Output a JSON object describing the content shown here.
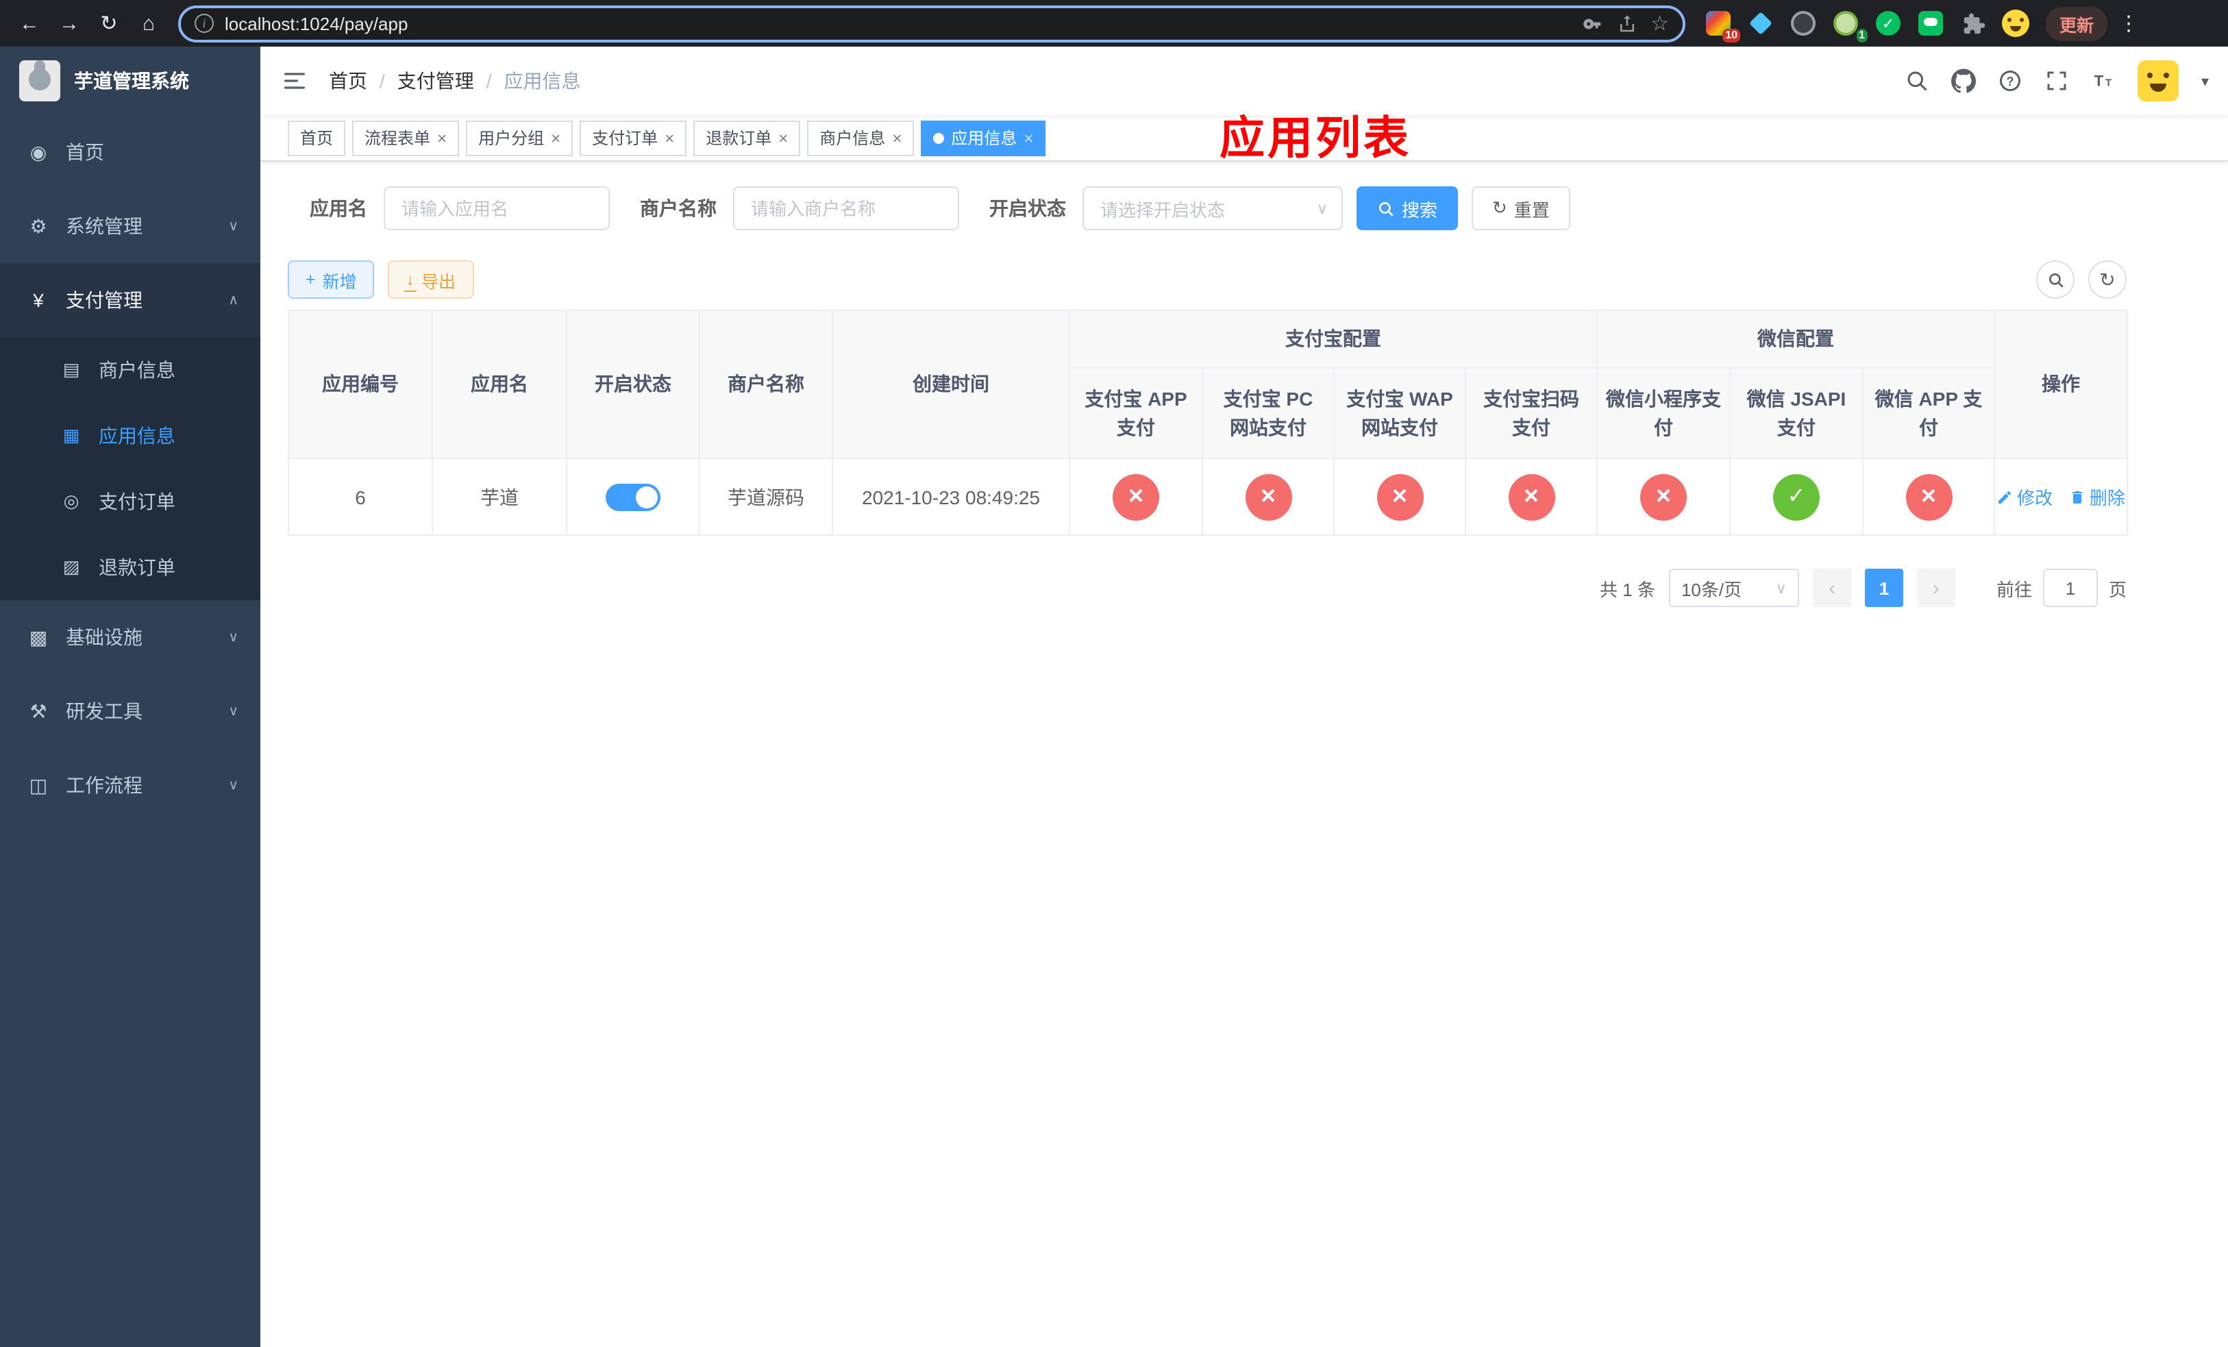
{
  "browser": {
    "url": "localhost:1024/pay/app",
    "update_label": "更新",
    "badges": {
      "extensions": "10",
      "profile_ext": "1"
    }
  },
  "app": {
    "annotation": "应用列表"
  },
  "icons": {
    "back": "←",
    "forward": "→",
    "reload": "↻",
    "home": "⌂",
    "info": "i",
    "star": "☆",
    "more": "⋮",
    "chevron_down": "∨",
    "chevron_up": "∧",
    "caret_down": "▾",
    "close": "×",
    "plus": "+",
    "download": "↓",
    "refresh": "↻",
    "check": "✓",
    "prev": "‹",
    "next": "›",
    "dashboard": "◉",
    "gear": "⚙",
    "yen": "¥",
    "monitor": "▩",
    "tool": "⚒",
    "flow": "◫",
    "card": "▤",
    "grid": "▦",
    "order": "◎",
    "doc": "▨"
  },
  "sidebar": {
    "title": "芋道管理系统",
    "items": [
      {
        "label": "首页"
      },
      {
        "label": "系统管理"
      },
      {
        "label": "支付管理",
        "children": [
          {
            "label": "商户信息"
          },
          {
            "label": "应用信息"
          },
          {
            "label": "支付订单"
          },
          {
            "label": "退款订单"
          }
        ]
      },
      {
        "label": "基础设施"
      },
      {
        "label": "研发工具"
      },
      {
        "label": "工作流程"
      }
    ]
  },
  "breadcrumb": {
    "separator": "/",
    "items": [
      "首页",
      "支付管理",
      "应用信息"
    ]
  },
  "tabs": [
    {
      "label": "首页"
    },
    {
      "label": "流程表单"
    },
    {
      "label": "用户分组"
    },
    {
      "label": "支付订单"
    },
    {
      "label": "退款订单"
    },
    {
      "label": "商户信息"
    },
    {
      "label": "应用信息"
    }
  ],
  "filters": {
    "app_name": {
      "label": "应用名",
      "placeholder": "请输入应用名"
    },
    "merchant_name": {
      "label": "商户名称",
      "placeholder": "请输入商户名称"
    },
    "status": {
      "label": "开启状态",
      "placeholder": "请选择开启状态"
    },
    "search_label": "搜索",
    "reset_label": "重置"
  },
  "actions": {
    "add_label": "新增",
    "export_label": "导出"
  },
  "table": {
    "group_headers": {
      "alipay": "支付宝配置",
      "wechat": "微信配置"
    },
    "columns": {
      "app_id": "应用编号",
      "app_name": "应用名",
      "status": "开启状态",
      "merchant_name": "商户名称",
      "create_time": "创建时间",
      "alipay_app": "支付宝 APP 支付",
      "alipay_pc": "支付宝 PC 网站支付",
      "alipay_wap": "支付宝 WAP 网站支付",
      "alipay_qr": "支付宝扫码支付",
      "wechat_mini": "微信小程序支付",
      "wechat_jsapi": "微信 JSAPI 支付",
      "wechat_app": "微信 APP 支付",
      "actions": "操作"
    },
    "rows": [
      {
        "app_id": "6",
        "app_name": "芋道",
        "status_on": true,
        "merchant_name": "芋道源码",
        "create_time": "2021-10-23 08:49:25",
        "config_statuses": [
          "disabled",
          "disabled",
          "disabled",
          "disabled",
          "disabled",
          "enabled",
          "disabled"
        ],
        "edit_label": "修改",
        "delete_label": "删除"
      }
    ]
  },
  "pagination": {
    "total_label": "共 1 条",
    "page_size_label": "10条/页",
    "current_page": "1",
    "goto_label": "前往",
    "goto_value": "1",
    "goto_suffix": "页"
  },
  "colors": {
    "accent": "#409eff",
    "success": "#67c23a",
    "danger": "#f56c6c",
    "warning_text": "#e6a23c",
    "sidebar_bg": "#304156",
    "submenu_bg": "#1f2d3d",
    "annotation": "#ff0000"
  }
}
